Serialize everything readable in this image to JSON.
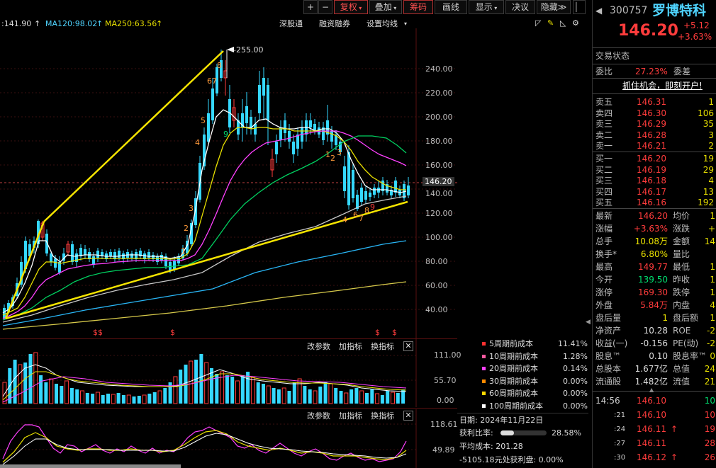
{
  "toolbar": {
    "plus": "+",
    "minus": "−",
    "fuquan": "复权",
    "diejia": "叠加",
    "chouma": "筹码",
    "huaxian": "画线",
    "xianshi": "显示",
    "jueyi": "决议",
    "yincang": "隐藏",
    "expand": "≫"
  },
  "ma_strip": {
    "ma1": ":141.90",
    "ma120": "MA120:98.02",
    "ma250": "MA250:63.56",
    "links": [
      "深股通",
      "融资融券",
      "设置均线"
    ]
  },
  "price_axis": [
    "240.00",
    "220.00",
    "200.00",
    "180.00",
    "160.00",
    "146.20",
    "140.00",
    "120.00",
    "100.00",
    "80.00",
    "60.00",
    "40.00"
  ],
  "annotations": {
    "high": "255.00",
    "dollars": [
      "$$",
      "$",
      "$",
      "$"
    ]
  },
  "td_counts": {
    "up": [
      "1",
      "2",
      "3",
      "4",
      "5",
      "6",
      "7",
      "8"
    ],
    "nine_top": "9",
    "down": [
      "1",
      "2",
      "3",
      "4",
      "6",
      "7",
      "8",
      "9"
    ]
  },
  "panel2": {
    "links": [
      "改参数",
      "加指标",
      "换指标"
    ],
    "axis": [
      "111.00",
      "55.70",
      "0.00"
    ],
    "close": "✕"
  },
  "panel3": {
    "links": [
      "改参数",
      "加指标",
      "换指标"
    ],
    "axis": [
      "118.61",
      "49.89"
    ],
    "close": "✕"
  },
  "chip": {
    "legend": [
      {
        "label": "5周期前成本",
        "value": "11.41%",
        "color": "#ff3030"
      },
      {
        "label": "10周期前成本",
        "value": "1.28%",
        "color": "#ff5aa0"
      },
      {
        "label": "20周期前成本",
        "value": "0.14%",
        "color": "#ff40ff"
      },
      {
        "label": "30周期前成本",
        "value": "0.00%",
        "color": "#ff8a00"
      },
      {
        "label": "60周期前成本",
        "value": "0.00%",
        "color": "#ffd800"
      },
      {
        "label": "100周期前成本",
        "value": "0.00%",
        "color": "#ffffff"
      }
    ],
    "date": "日期: 2024年11月22日",
    "profit_label": "获利比率:",
    "profit_value": "28.58%",
    "profit_ratio": 0.2858,
    "avg": "平均成本: 201.28",
    "dispose": "-5105.18元处获利盘: 0.00%"
  },
  "quote": {
    "code": "300757",
    "name": "罗博特科",
    "price": "146.20",
    "change": "+5.12",
    "change_pct": "+3.63%",
    "status_label": "交易状态",
    "weibi_label": "委比",
    "weibi": "27.23%",
    "weicha_label": "委差",
    "banner": "抓住机会，即刻开户!",
    "sells": [
      {
        "l": "卖五",
        "p": "146.31",
        "v": "1"
      },
      {
        "l": "卖四",
        "p": "146.30",
        "v": "106"
      },
      {
        "l": "卖三",
        "p": "146.29",
        "v": "35"
      },
      {
        "l": "卖二",
        "p": "146.28",
        "v": "3"
      },
      {
        "l": "卖一",
        "p": "146.21",
        "v": "2"
      }
    ],
    "buys": [
      {
        "l": "买一",
        "p": "146.20",
        "v": "19"
      },
      {
        "l": "买二",
        "p": "146.19",
        "v": "29"
      },
      {
        "l": "买三",
        "p": "146.18",
        "v": "4"
      },
      {
        "l": "买四",
        "p": "146.17",
        "v": "13"
      },
      {
        "l": "买五",
        "p": "146.16",
        "v": "192"
      }
    ],
    "stats": [
      {
        "l1": "最新",
        "v1": "146.20",
        "c1": "red",
        "l2": "均价",
        "v2": "1"
      },
      {
        "l1": "涨幅",
        "v1": "+3.63%",
        "c1": "red",
        "l2": "涨跌",
        "v2": "+"
      },
      {
        "l1": "总手",
        "v1": "10.08万",
        "c1": "yel",
        "l2": "金额",
        "v2": "14"
      },
      {
        "l1": "换手*",
        "v1": "6.80%",
        "c1": "yel",
        "l2": "量比",
        "v2": ""
      },
      {
        "l1": "最高",
        "v1": "149.77",
        "c1": "red",
        "l2": "最低",
        "v2": "1"
      },
      {
        "l1": "今开",
        "v1": "139.50",
        "c1": "grn",
        "l2": "昨收",
        "v2": "1"
      },
      {
        "l1": "涨停",
        "v1": "169.30",
        "c1": "red",
        "l2": "跌停",
        "v2": "1"
      },
      {
        "l1": "外盘",
        "v1": "5.84万",
        "c1": "red",
        "l2": "内盘",
        "v2": "4"
      },
      {
        "l1": "盘后量",
        "v1": "1",
        "c1": "yel",
        "l2": "盘后额",
        "v2": "1"
      },
      {
        "l1": "净资产",
        "v1": "10.28",
        "c1": "wht",
        "l2": "ROE",
        "v2": "-2"
      },
      {
        "l1": "收益(一)",
        "v1": "-0.156",
        "c1": "wht",
        "l2": "PE(动)",
        "v2": "-2"
      },
      {
        "l1": "股息™",
        "v1": "0.10",
        "c1": "wht",
        "l2": "股息率™",
        "v2": "0"
      },
      {
        "l1": "总股本",
        "v1": "1.677亿",
        "c1": "wht",
        "l2": "总值",
        "v2": "24"
      },
      {
        "l1": "流通股",
        "v1": "1.482亿",
        "c1": "wht",
        "l2": "流值",
        "v2": "21"
      }
    ],
    "ticks": [
      {
        "t": "14:56",
        "p": "146.10",
        "v": "10",
        "vc": "grn",
        "a": ""
      },
      {
        "t": ":21",
        "p": "146.10",
        "v": "10",
        "vc": "red",
        "a": ""
      },
      {
        "t": ":24",
        "p": "146.11",
        "v": "19",
        "vc": "red",
        "a": "↑"
      },
      {
        "t": ":27",
        "p": "146.11",
        "v": "28",
        "vc": "red",
        "a": ""
      },
      {
        "t": ":30",
        "p": "146.12",
        "v": "26",
        "vc": "red",
        "a": "↑"
      }
    ]
  }
}
